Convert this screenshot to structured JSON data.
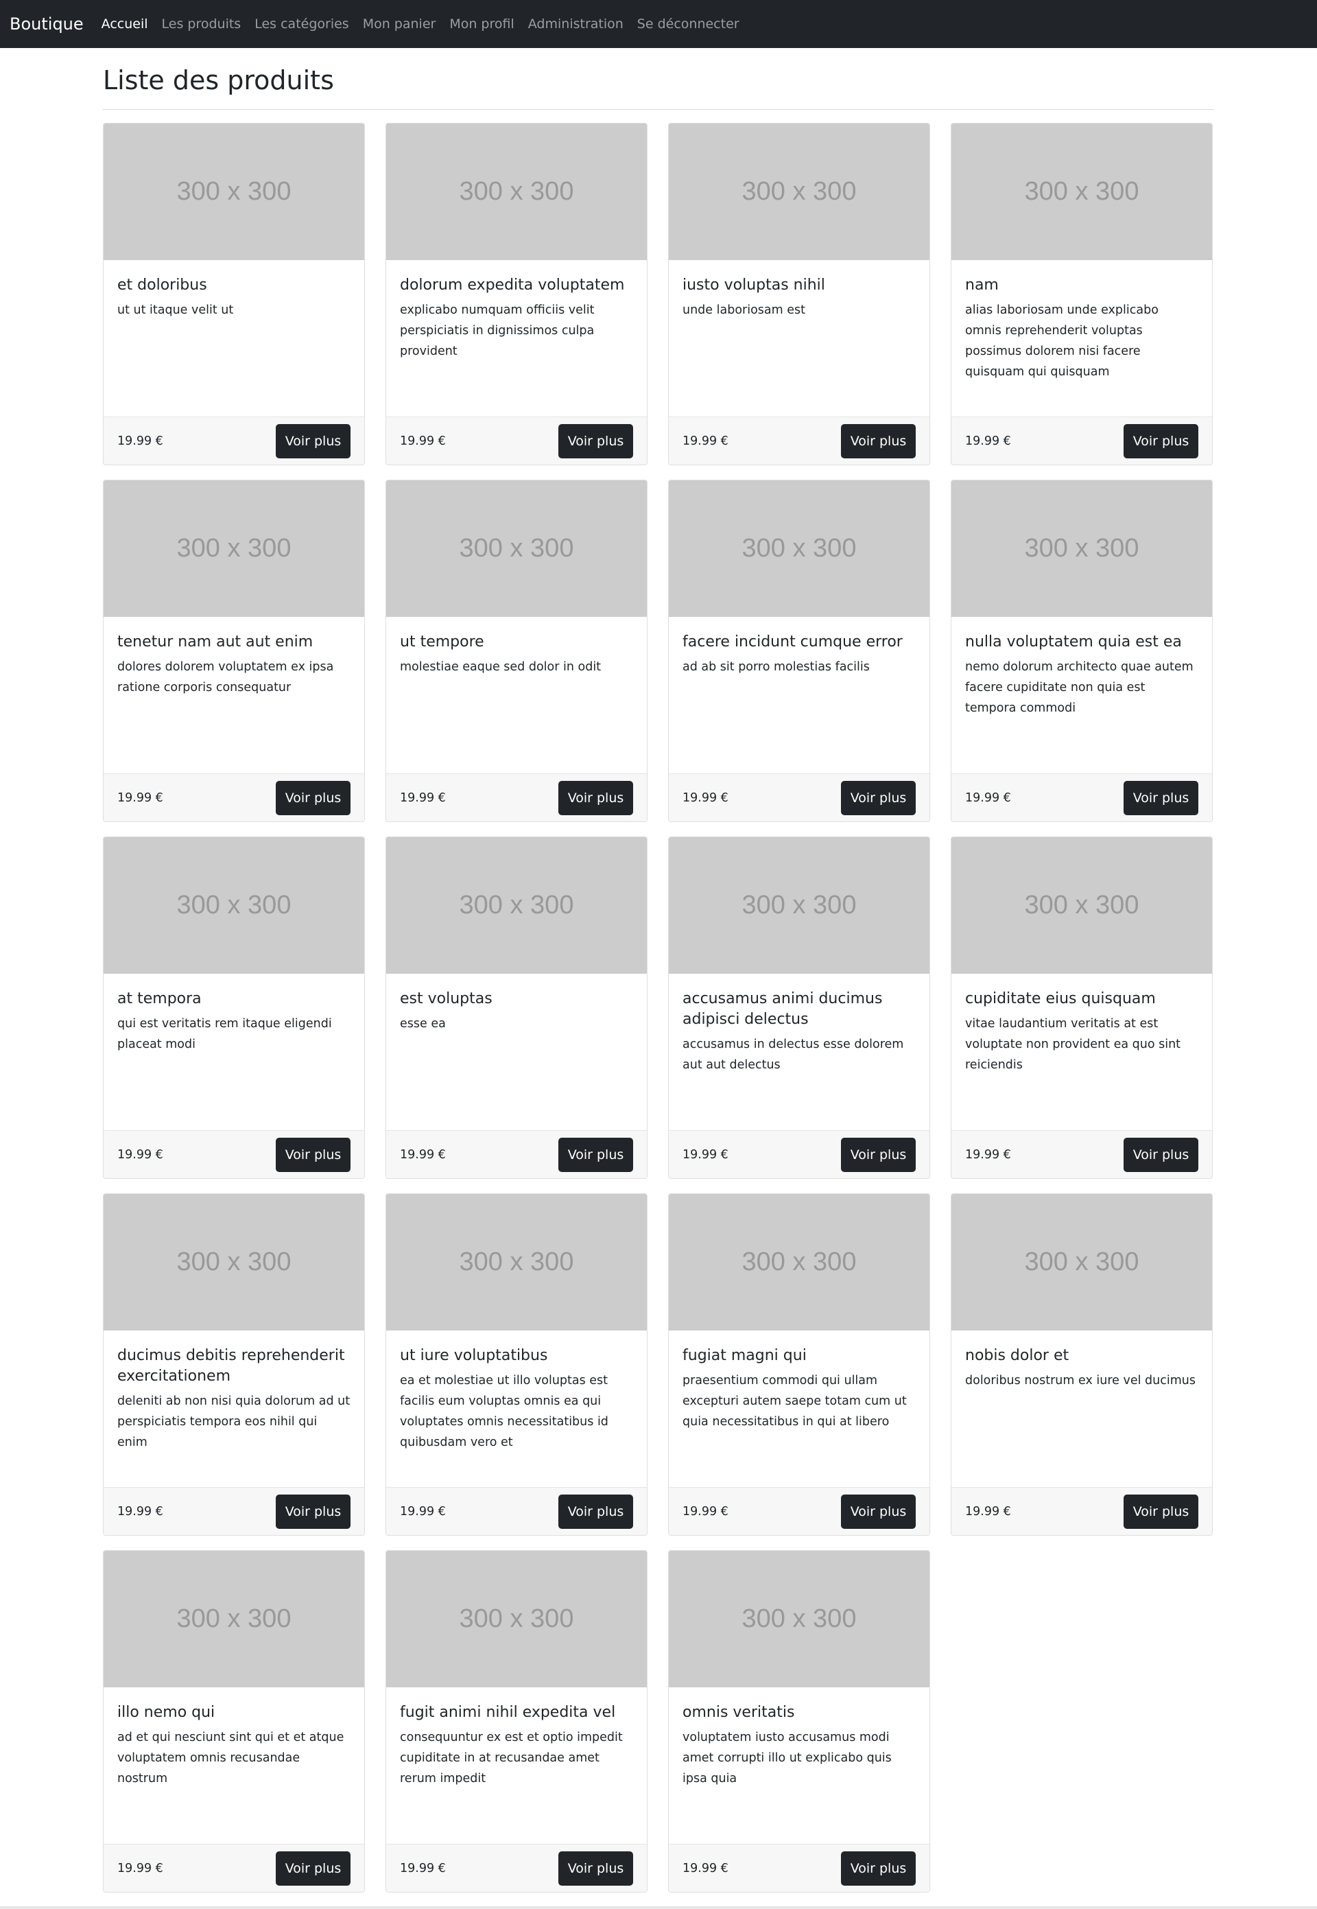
{
  "navbar": {
    "brand": "Boutique",
    "links": [
      {
        "label": "Accueil",
        "active": true
      },
      {
        "label": "Les produits",
        "active": false
      },
      {
        "label": "Les catégories",
        "active": false
      },
      {
        "label": "Mon panier",
        "active": false
      },
      {
        "label": "Mon profil",
        "active": false
      },
      {
        "label": "Administration",
        "active": false
      },
      {
        "label": "Se déconnecter",
        "active": false
      }
    ]
  },
  "page": {
    "title": "Liste des produits",
    "button_label": "Voir plus",
    "image_placeholder": "300 x 300"
  },
  "products": [
    {
      "title": "et doloribus",
      "description": "ut ut itaque velit ut",
      "price": "19.99 €"
    },
    {
      "title": "dolorum expedita voluptatem",
      "description": "explicabo numquam officiis velit perspiciatis in dignissimos culpa provident",
      "price": "19.99 €"
    },
    {
      "title": "iusto voluptas nihil",
      "description": "unde laboriosam est",
      "price": "19.99 €"
    },
    {
      "title": "nam",
      "description": "alias laboriosam unde explicabo omnis reprehenderit voluptas possimus dolorem nisi facere quisquam qui quisquam",
      "price": "19.99 €"
    },
    {
      "title": "tenetur nam aut aut enim",
      "description": "dolores dolorem voluptatem ex ipsa ratione corporis consequatur",
      "price": "19.99 €"
    },
    {
      "title": "ut tempore",
      "description": "molestiae eaque sed dolor in odit",
      "price": "19.99 €"
    },
    {
      "title": "facere incidunt cumque error",
      "description": "ad ab sit porro molestias facilis",
      "price": "19.99 €"
    },
    {
      "title": "nulla voluptatem quia est ea",
      "description": "nemo dolorum architecto quae autem facere cupiditate non quia est tempora commodi",
      "price": "19.99 €"
    },
    {
      "title": "at tempora",
      "description": "qui est veritatis rem itaque eligendi placeat modi",
      "price": "19.99 €"
    },
    {
      "title": "est voluptas",
      "description": "esse ea",
      "price": "19.99 €"
    },
    {
      "title": "accusamus animi ducimus adipisci delectus",
      "description": "accusamus in delectus esse dolorem aut aut delectus",
      "price": "19.99 €"
    },
    {
      "title": "cupiditate eius quisquam",
      "description": "vitae laudantium veritatis at est voluptate non provident ea quo sint reiciendis",
      "price": "19.99 €"
    },
    {
      "title": "ducimus debitis reprehenderit exercitationem",
      "description": "deleniti ab non nisi quia dolorum ad ut perspiciatis tempora eos nihil qui enim",
      "price": "19.99 €"
    },
    {
      "title": "ut iure voluptatibus",
      "description": "ea et molestiae ut illo voluptas est facilis eum voluptas omnis ea qui voluptates omnis necessitatibus id quibusdam vero et",
      "price": "19.99 €"
    },
    {
      "title": "fugiat magni qui",
      "description": "praesentium commodi qui ullam excepturi autem saepe totam cum ut quia necessitatibus in qui at libero",
      "price": "19.99 €"
    },
    {
      "title": "nobis dolor et",
      "description": "doloribus nostrum ex iure vel ducimus",
      "price": "19.99 €"
    },
    {
      "title": "illo nemo qui",
      "description": "ad et qui nesciunt sint qui et et atque voluptatem omnis recusandae nostrum",
      "price": "19.99 €"
    },
    {
      "title": "fugit animi nihil expedita vel",
      "description": "consequuntur ex est et optio impedit cupiditate in at recusandae amet rerum impedit",
      "price": "19.99 €"
    },
    {
      "title": "omnis veritatis",
      "description": "voluptatem iusto accusamus modi amet corrupti illo ut explicabo quis ipsa quia",
      "price": "19.99 €"
    }
  ]
}
